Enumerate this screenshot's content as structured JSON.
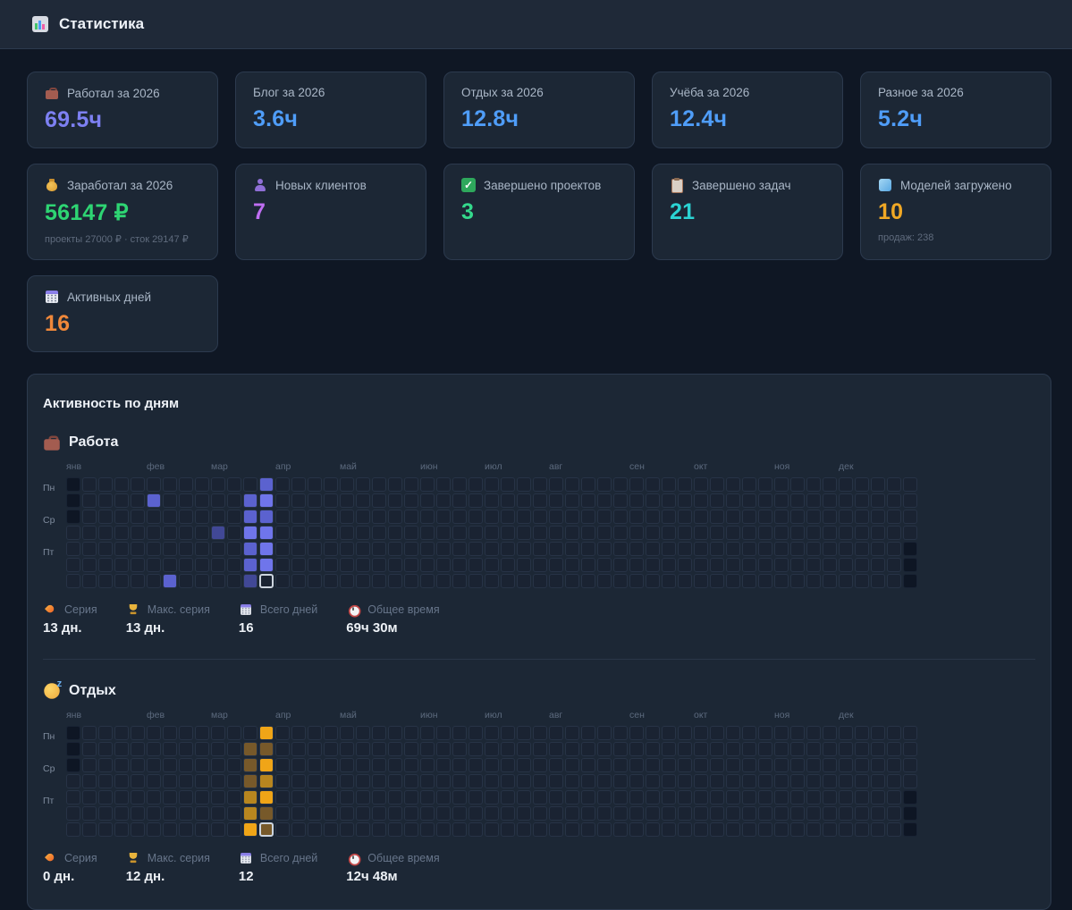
{
  "header": {
    "icon": "chart-icon",
    "title": "Статистика"
  },
  "stat_cards": [
    {
      "icon": "briefcase-icon",
      "label": "Работал за 2026",
      "value": "69.5ч",
      "color": "#7d80f2"
    },
    {
      "icon": "",
      "label": "Блог за 2026",
      "value": "3.6ч",
      "color": "#4f9df8"
    },
    {
      "icon": "",
      "label": "Отдых за 2026",
      "value": "12.8ч",
      "color": "#4f9df8"
    },
    {
      "icon": "",
      "label": "Учёба за 2026",
      "value": "12.4ч",
      "color": "#4f9df8"
    },
    {
      "icon": "",
      "label": "Разное за 2026",
      "value": "5.2ч",
      "color": "#4f9df8"
    },
    {
      "icon": "money-icon",
      "label": "Заработал за 2026",
      "value": "56147 ₽",
      "color": "#2ed573",
      "sub": "проекты 27000 ₽ · сток 29147 ₽"
    },
    {
      "icon": "user-icon",
      "label": "Новых клиентов",
      "value": "7",
      "color": "#bf6ef2"
    },
    {
      "icon": "check-icon",
      "label": "Завершено проектов",
      "value": "3",
      "color": "#34d98c"
    },
    {
      "icon": "clipboard-icon",
      "label": "Завершено задач",
      "value": "21",
      "color": "#2bd3d3"
    },
    {
      "icon": "cube-icon",
      "label": "Моделей загружено",
      "value": "10",
      "color": "#f0a825",
      "sub": "продаж: 238"
    },
    {
      "icon": "calendar-icon",
      "label": "Активных дней",
      "value": "16",
      "color": "#f0883a"
    }
  ],
  "chart_data": [
    {
      "type": "heatmap",
      "title": "Работа",
      "x": "weeks 0-52 of 2026",
      "y": "days Пн-Вс",
      "legend_position": "none",
      "active_cells_col_row_level": [
        [
          12,
          0,
          2
        ],
        [
          5,
          1,
          2
        ],
        [
          11,
          1,
          2
        ],
        [
          12,
          1,
          3
        ],
        [
          11,
          2,
          2
        ],
        [
          12,
          2,
          2
        ],
        [
          9,
          3,
          1
        ],
        [
          11,
          3,
          3
        ],
        [
          12,
          3,
          3
        ],
        [
          11,
          4,
          2
        ],
        [
          12,
          4,
          3
        ],
        [
          11,
          5,
          2
        ],
        [
          12,
          5,
          3
        ],
        [
          6,
          6,
          2
        ],
        [
          11,
          6,
          1
        ]
      ],
      "today_cell": [
        12,
        6
      ],
      "stats": {
        "Серия": "13 дн.",
        "Макс. серия": "13 дн.",
        "Всего дней": "16",
        "Общее время": "69ч 30м"
      }
    },
    {
      "type": "heatmap",
      "title": "Отдых",
      "x": "weeks 0-52 of 2026",
      "y": "days Пн-Вс",
      "legend_position": "none",
      "active_cells_col_row_level": [
        [
          12,
          0,
          3
        ],
        [
          11,
          1,
          1
        ],
        [
          12,
          1,
          1
        ],
        [
          11,
          2,
          1
        ],
        [
          12,
          2,
          3
        ],
        [
          11,
          3,
          1
        ],
        [
          12,
          3,
          2
        ],
        [
          11,
          4,
          2
        ],
        [
          12,
          4,
          3
        ],
        [
          11,
          5,
          2
        ],
        [
          12,
          5,
          1
        ],
        [
          11,
          6,
          3
        ]
      ],
      "today_cell": [
        12,
        6
      ],
      "stats": {
        "Серия": "0 дн.",
        "Макс. серия": "12 дн.",
        "Всего дней": "12",
        "Общее время": "12ч 48м"
      }
    }
  ],
  "activity": {
    "title": "Активность по дням",
    "weeks": 53,
    "months": [
      "янв",
      "фев",
      "мар",
      "апр",
      "май",
      "июн",
      "июл",
      "авг",
      "сен",
      "окт",
      "ноя",
      "дек"
    ],
    "month_cols": [
      0,
      5,
      9,
      13,
      17,
      22,
      26,
      30,
      35,
      39,
      44,
      48
    ],
    "day_labels": [
      {
        "row": 0,
        "label": "Пн"
      },
      {
        "row": 2,
        "label": "Ср"
      },
      {
        "row": 4,
        "label": "Пт"
      }
    ],
    "out_of_range": [
      [
        0,
        0
      ],
      [
        0,
        1
      ],
      [
        0,
        2
      ],
      [
        52,
        4
      ],
      [
        52,
        5
      ],
      [
        52,
        6
      ]
    ],
    "stat_labels": [
      {
        "icon": "fire-icon",
        "label": "Серия"
      },
      {
        "icon": "trophy-icon",
        "label": "Макс. серия"
      },
      {
        "icon": "calendar-icon",
        "label": "Всего дней"
      },
      {
        "icon": "clock-icon",
        "label": "Общее время"
      }
    ],
    "sections": [
      {
        "icon": "briefcase-icon",
        "name": "Работа",
        "palette": [
          "#414896",
          "#5b62cf",
          "#6f75eb"
        ],
        "cells": [
          [
            12,
            0,
            2
          ],
          [
            5,
            1,
            2
          ],
          [
            11,
            1,
            2
          ],
          [
            12,
            1,
            3
          ],
          [
            11,
            2,
            2
          ],
          [
            12,
            2,
            2
          ],
          [
            9,
            3,
            1
          ],
          [
            11,
            3,
            3
          ],
          [
            12,
            3,
            3
          ],
          [
            11,
            4,
            2
          ],
          [
            12,
            4,
            3
          ],
          [
            11,
            5,
            2
          ],
          [
            12,
            5,
            3
          ],
          [
            6,
            6,
            2
          ],
          [
            11,
            6,
            1
          ]
        ],
        "today": [
          12,
          6,
          0
        ],
        "stats": [
          "13 дн.",
          "13 дн.",
          "16",
          "69ч 30м"
        ]
      },
      {
        "icon": "sleep-icon",
        "name": "Отдых",
        "palette": [
          "#77592a",
          "#b8861f",
          "#f0a517"
        ],
        "cells": [
          [
            12,
            0,
            3
          ],
          [
            11,
            1,
            1
          ],
          [
            12,
            1,
            1
          ],
          [
            11,
            2,
            1
          ],
          [
            12,
            2,
            3
          ],
          [
            11,
            3,
            1
          ],
          [
            12,
            3,
            2
          ],
          [
            11,
            4,
            2
          ],
          [
            12,
            4,
            3
          ],
          [
            11,
            5,
            2
          ],
          [
            12,
            5,
            1
          ],
          [
            11,
            6,
            3
          ]
        ],
        "today": [
          12,
          6,
          1
        ],
        "stats": [
          "0 дн.",
          "12 дн.",
          "12",
          "12ч 48м"
        ]
      }
    ]
  }
}
